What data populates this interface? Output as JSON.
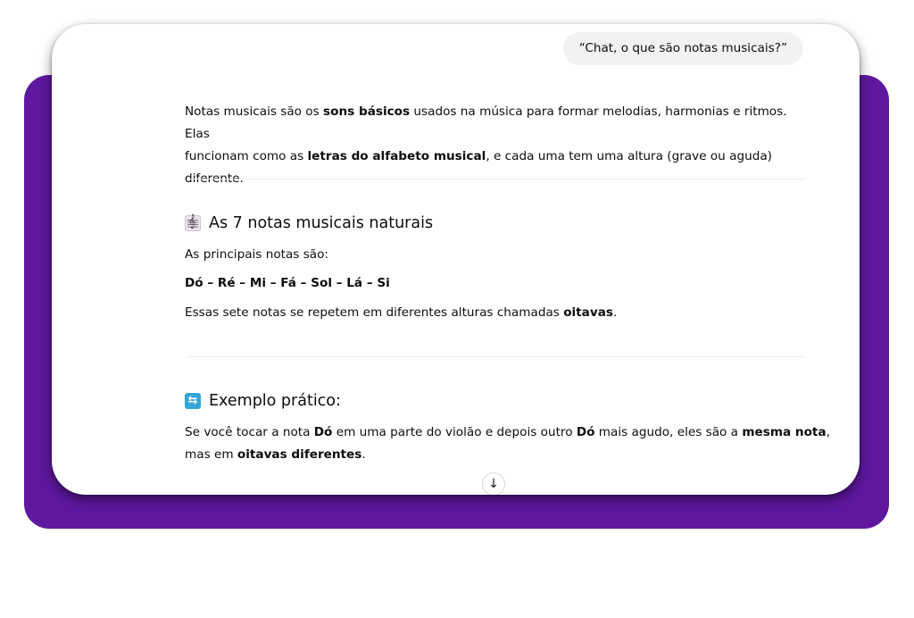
{
  "colors": {
    "backdrop": "#5f17a0",
    "user_bubble_bg": "#f2f2f2",
    "card_bg": "#ffffff",
    "text": "#0d0d0d"
  },
  "user_message": "“Chat, o que são notas musicais?”",
  "intro": {
    "p1_a": "Notas musicais são os ",
    "p1_b": "sons básicos",
    "p1_c": " usados na música para formar melodias, harmonias e ritmos. Elas",
    "p2_a": "funcionam como as ",
    "p2_b": "letras do alfabeto musical",
    "p2_c": ", e cada uma tem uma altura (grave ou aguda) diferente."
  },
  "section1": {
    "icon": "musical-score-icon",
    "title": "As 7 notas musicais naturais",
    "line1": "As principais notas são:",
    "notes": "Dó – Ré – Mi – Fá – Sol – Lá – Si",
    "line3_a": "Essas sete notas se repetem em diferentes alturas chamadas ",
    "line3_b": "oitavas",
    "line3_c": "."
  },
  "section2": {
    "icon": "repeat-icon",
    "title": "Exemplo prático:",
    "l1_a": "Se você tocar a nota ",
    "l1_b": "Dó",
    "l1_c": " em uma parte do violão e depois outro ",
    "l1_d": "Dó",
    "l1_e": " mais agudo, eles são a ",
    "l1_f": "mesma nota",
    "l1_g": ",",
    "l2_a": "mas em ",
    "l2_b": "oitavas diferentes",
    "l2_c": "."
  },
  "scroll_button_icon": "arrow-down-icon",
  "scroll_button_glyph": "↓"
}
